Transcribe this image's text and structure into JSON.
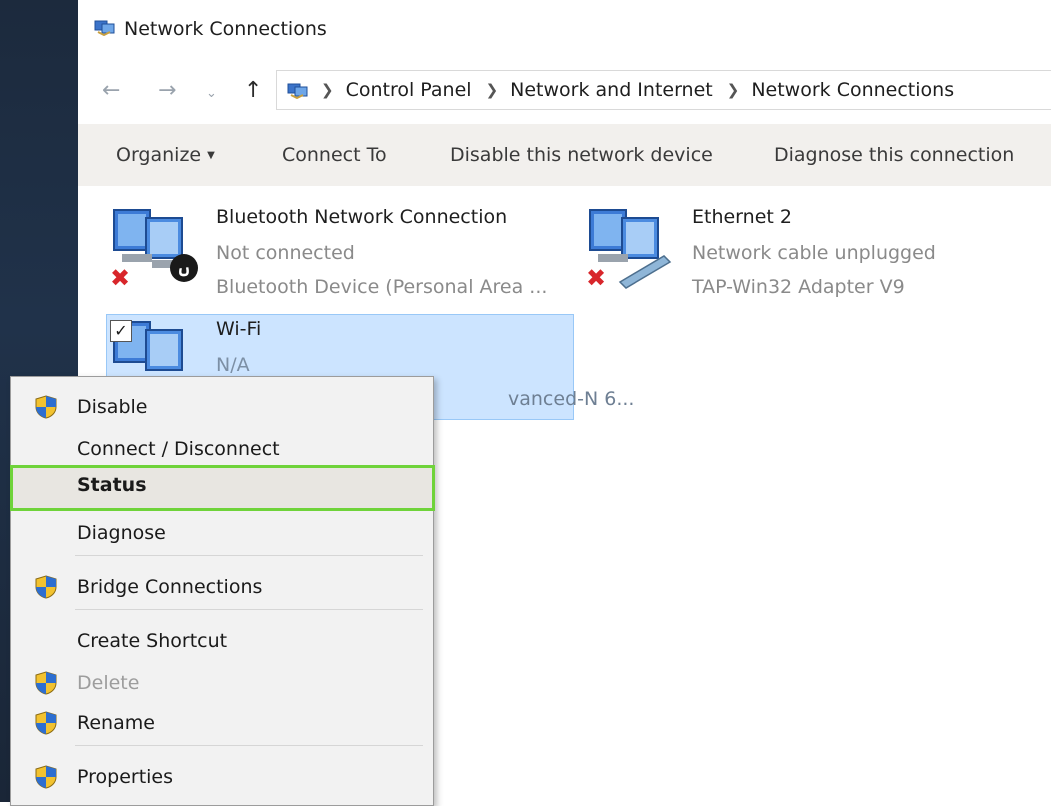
{
  "window": {
    "title": "Network Connections"
  },
  "address": {
    "breadcrumbs": [
      "Control Panel",
      "Network and Internet",
      "Network Connections"
    ]
  },
  "commands": {
    "organize": "Organize",
    "connect_to": "Connect To",
    "disable_device": "Disable this network device",
    "diagnose": "Diagnose this connection"
  },
  "items": [
    {
      "name": "Bluetooth Network Connection",
      "status": "Not connected",
      "device": "Bluetooth Device (Personal Area ..."
    },
    {
      "name": "Ethernet 2",
      "status": "Network cable unplugged",
      "device": "TAP-Win32 Adapter V9"
    },
    {
      "name": "Wi-Fi",
      "status": "N/A",
      "device": "vanced-N 6..."
    }
  ],
  "context_menu": {
    "items": [
      {
        "label": "Disable",
        "icon": "shield-icon"
      },
      {
        "label": "Connect / Disconnect"
      },
      {
        "label": "Status",
        "highlighted": true
      },
      {
        "label": "Diagnose"
      },
      {
        "label": "Bridge Connections",
        "icon": "shield-icon"
      },
      {
        "label": "Create Shortcut"
      },
      {
        "label": "Delete",
        "icon": "shield-icon",
        "disabled": true
      },
      {
        "label": "Rename",
        "icon": "shield-icon"
      },
      {
        "label": "Properties",
        "icon": "shield-icon"
      }
    ]
  },
  "colors": {
    "highlight_border": "#6fd33a",
    "selection_bg": "#cce4ff",
    "command_bar_bg": "#f2f0ed"
  }
}
